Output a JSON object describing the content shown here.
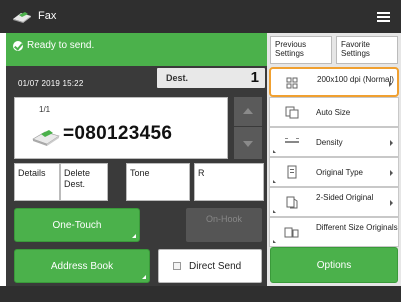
{
  "header": {
    "title": "Fax",
    "app_icon": "fax-icon",
    "menu_icon": "menu-icon"
  },
  "status": {
    "text": "Ready to send.",
    "datetime": "01/07 2019 15:22"
  },
  "destination": {
    "label": "Dest.",
    "count": "1",
    "page": "1/1",
    "number": "=080123456"
  },
  "tabs": [
    {
      "label": "Details"
    },
    {
      "label": "Delete Dest."
    },
    {
      "label": "Tone"
    },
    {
      "label": "R"
    }
  ],
  "buttons": {
    "one_touch": "One-Touch",
    "on_hook": "On-Hook",
    "address_book": "Address Book",
    "direct_send": "Direct Send",
    "options": "Options"
  },
  "shortcuts": {
    "previous": "Previous Settings",
    "favorite": "Favorite Settings"
  },
  "settings": [
    {
      "label": "200x100 dpi (Normal)",
      "icon": "resolution-icon",
      "selected": true
    },
    {
      "label": "Auto Size",
      "icon": "copy-size-icon",
      "selected": false
    },
    {
      "label": "Density",
      "icon": "density-icon",
      "selected": false
    },
    {
      "label": "Original Type",
      "icon": "document-icon",
      "selected": false
    },
    {
      "label": "2-Sided Original",
      "icon": "two-sided-icon",
      "selected": false
    },
    {
      "label": "Different Size Originals",
      "icon": "different-size-icon",
      "selected": false
    }
  ],
  "colors": {
    "accent_green": "#4bb14b",
    "selection_orange": "#f0a030",
    "dark_bg": "#3a3a3a"
  }
}
